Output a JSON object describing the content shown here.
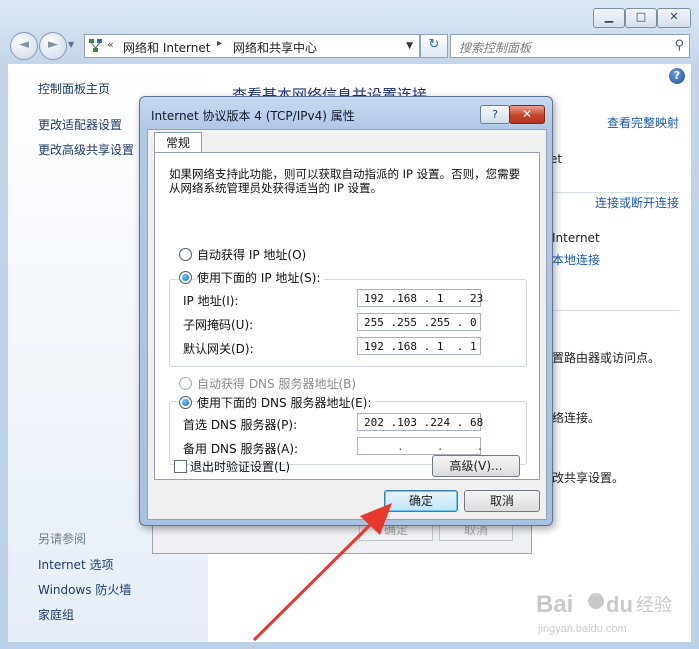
{
  "window": {
    "caption": {
      "minimize": "▁",
      "maximize": "□",
      "close": "✕"
    },
    "nav": {
      "back_icon": "◄",
      "forward_icon": "►",
      "dropdown_icon": "▼"
    },
    "address": {
      "chevron": "«",
      "crumb1": "网络和 Internet",
      "separator": "▸",
      "crumb2": "网络和共享中心",
      "dropdown_icon": "▼"
    },
    "refresh_icon": "↻",
    "search": {
      "placeholder": "搜索控制面板",
      "icon": "⚲"
    }
  },
  "sidebar": {
    "home": "控制面板主页",
    "adapter_settings": "更改适配器设置",
    "advanced_sharing": "更改高级共享设置",
    "see_also": "另请参阅",
    "internet_options": "Internet 选项",
    "firewall": "Windows 防火墙",
    "homegroup": "家庭组"
  },
  "main": {
    "help": "?",
    "heading": "查看基本网络信息并设置连接",
    "view_full_map": "查看完整映射",
    "net_fragment": "et",
    "connect_disconnect": "连接或断开连接",
    "internet_fragment": "Internet",
    "local_connection": "本地连接",
    "text_router": "置路由器或访问点。",
    "text_connect": "络连接。",
    "text_sharing": "改共享设置。"
  },
  "background_dialog": {
    "ok": "确定",
    "cancel": "取消"
  },
  "dialog": {
    "title": "Internet 协议版本 4 (TCP/IPv4) 属性",
    "help_button": "?",
    "close_button": "✕",
    "tab": "常规",
    "intro": "如果网络支持此功能，则可以获取自动指派的 IP 设置。否则，您需要从网络系统管理员处获得适当的 IP 设置。",
    "auto_ip": "自动获得 IP 地址(O)",
    "manual_ip": "使用下面的 IP 地址(S):",
    "ip_label": "IP 地址(I):",
    "ip_value": "192 .168 . 1  . 23",
    "subnet_label": "子网掩码(U):",
    "subnet_value": "255 .255 .255 . 0",
    "gateway_label": "默认网关(D):",
    "gateway_value": "192 .168 . 1  . 1",
    "auto_dns": "自动获得 DNS 服务器地址(B)",
    "manual_dns": "使用下面的 DNS 服务器地址(E):",
    "preferred_dns_label": "首选 DNS 服务器(P):",
    "preferred_dns_value": "202 .103 .224 . 68",
    "alternate_dns_label": "备用 DNS 服务器(A):",
    "alternate_dns_value": "     .     .     .",
    "validate_on_exit": "退出时验证设置(L)",
    "advanced": "高级(V)...",
    "ok": "确定",
    "cancel": "取消"
  },
  "watermark": {
    "brand": "Bai",
    "paw": "du",
    "jy": "经验",
    "url": "jingyan.baidu.com"
  },
  "colors": {
    "link": "#1a5bb5",
    "arrow": "#e8382e",
    "heading": "#1e3287"
  }
}
